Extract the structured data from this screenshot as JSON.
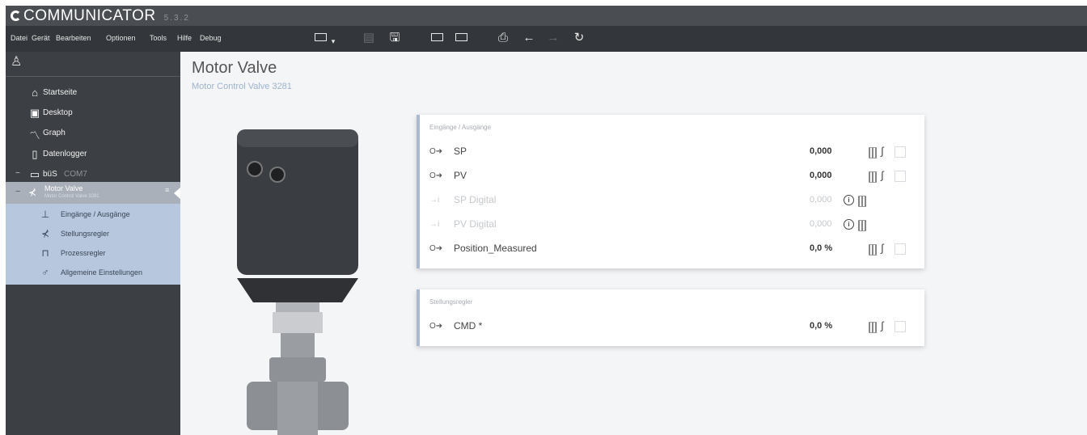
{
  "titlebar": {
    "app_name": "COMMUNICATOR",
    "version": "5.3.2"
  },
  "menu": [
    "Datei",
    "Gerät",
    "Bearbeiten",
    "Optionen",
    "Tools",
    "Hilfe",
    "Debug"
  ],
  "toolbar": {
    "icons": [
      "device-connect-icon",
      "dropdown-icon",
      "save-disabled-icon",
      "save-icon",
      "import-icon",
      "export-icon",
      "report-icon",
      "back-icon",
      "forward-icon",
      "refresh-icon"
    ]
  },
  "sidebar": {
    "nav": [
      {
        "label": "Startseite",
        "icon": "home-icon"
      },
      {
        "label": "Desktop",
        "icon": "desktop-icon"
      },
      {
        "label": "Graph",
        "icon": "graph-icon"
      },
      {
        "label": "Datenlogger",
        "icon": "datalogger-icon"
      }
    ],
    "bus": {
      "label": "büS",
      "port": "COM7"
    },
    "device": {
      "name": "Motor Valve",
      "subtitle": "Motor Control Valve 3281"
    },
    "sub_items": [
      {
        "label": "Eingänge / Ausgänge",
        "icon": "io-icon"
      },
      {
        "label": "Stellungsregler",
        "icon": "positioner-icon"
      },
      {
        "label": "Prozessregler",
        "icon": "process-controller-icon"
      },
      {
        "label": "Allgemeine Einstellungen",
        "icon": "settings-icon"
      }
    ]
  },
  "page": {
    "title": "Motor Valve",
    "subtitle": "Motor Control Valve 3281"
  },
  "panels": {
    "io": {
      "header": "Eingänge / Ausgänge",
      "rows": [
        {
          "prefix": "O➜",
          "name": "SP",
          "value": "0,000",
          "disabled": false
        },
        {
          "prefix": "O➜",
          "name": "PV",
          "value": "0,000",
          "disabled": false
        },
        {
          "prefix": "→i",
          "name": "SP Digital",
          "value": "0,000",
          "disabled": true
        },
        {
          "prefix": "→i",
          "name": "PV Digital",
          "value": "0,000",
          "disabled": true
        },
        {
          "prefix": "O➜",
          "name": "Position_Measured",
          "value": "0,0 %",
          "disabled": false
        }
      ]
    },
    "positioner": {
      "header": "Stellungsregler",
      "rows": [
        {
          "prefix": "O➜",
          "name": "CMD *",
          "value": "0,0 %",
          "disabled": false
        }
      ]
    }
  },
  "colors": {
    "accent": "#a9bad0",
    "sidebar": "#3c3f43",
    "menubar": "#33363a",
    "titlebar": "#4a4d52",
    "subnav": "#b7c8de"
  }
}
